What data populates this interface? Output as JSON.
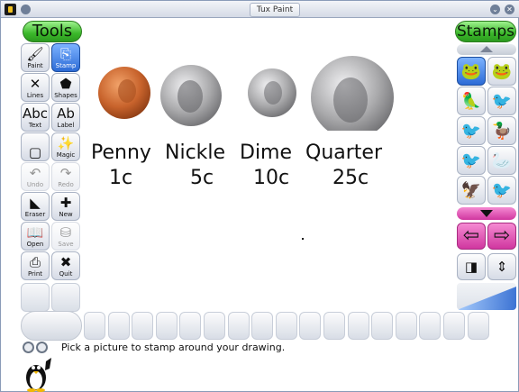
{
  "window": {
    "title": "Tux Paint"
  },
  "toolbar": {
    "header": "Tools",
    "tools": [
      {
        "label": "Paint",
        "icon": "paintbrush-icon",
        "glyph": "🖌",
        "selected": false,
        "disabled": false
      },
      {
        "label": "Stamp",
        "icon": "stamp-icon",
        "glyph": "⎘",
        "selected": true,
        "disabled": false
      },
      {
        "label": "Lines",
        "icon": "lines-icon",
        "glyph": "✕",
        "selected": false,
        "disabled": false
      },
      {
        "label": "Shapes",
        "icon": "pentagon-icon",
        "glyph": "⬟",
        "selected": false,
        "disabled": false
      },
      {
        "label": "Text",
        "icon": "text-icon",
        "glyph": "Abc",
        "selected": false,
        "disabled": false
      },
      {
        "label": "Label",
        "icon": "label-icon",
        "glyph": "Ab",
        "selected": false,
        "disabled": false
      },
      {
        "label": "",
        "icon": "fill-square-icon",
        "glyph": "▢",
        "selected": false,
        "disabled": false
      },
      {
        "label": "Magic",
        "icon": "magic-wand-icon",
        "glyph": "✨",
        "selected": false,
        "disabled": false
      },
      {
        "label": "Undo",
        "icon": "undo-icon",
        "glyph": "↶",
        "selected": false,
        "disabled": true
      },
      {
        "label": "Redo",
        "icon": "redo-icon",
        "glyph": "↷",
        "selected": false,
        "disabled": true
      },
      {
        "label": "Eraser",
        "icon": "eraser-icon",
        "glyph": "◣",
        "selected": false,
        "disabled": false
      },
      {
        "label": "New",
        "icon": "new-page-icon",
        "glyph": "✚",
        "selected": false,
        "disabled": false
      },
      {
        "label": "Open",
        "icon": "open-book-icon",
        "glyph": "📖",
        "selected": false,
        "disabled": false
      },
      {
        "label": "Save",
        "icon": "save-icon",
        "glyph": "⛁",
        "selected": false,
        "disabled": true
      },
      {
        "label": "Print",
        "icon": "print-icon",
        "glyph": "⎙",
        "selected": false,
        "disabled": false
      },
      {
        "label": "Quit",
        "icon": "quit-x-icon",
        "glyph": "✖",
        "selected": false,
        "disabled": false
      }
    ]
  },
  "canvas": {
    "coins": [
      {
        "name": "Penny",
        "value": "1c",
        "color": "#c8632c"
      },
      {
        "name": "Nickle",
        "value": "5c",
        "color": "#a9a9ab"
      },
      {
        "name": "Dime",
        "value": "10c",
        "color": "#b4b4b6"
      },
      {
        "name": "Quarter",
        "value": "25c",
        "color": "#a8a8aa"
      }
    ]
  },
  "stamps": {
    "header": "Stamps",
    "items": [
      {
        "icon": "frog-brown-icon",
        "glyph": "🐸",
        "selected": true
      },
      {
        "icon": "frog-green-icon",
        "glyph": "🐸",
        "selected": false
      },
      {
        "icon": "parrot-icon",
        "glyph": "🦜",
        "selected": false
      },
      {
        "icon": "bird-yellow-icon",
        "glyph": "🐦",
        "selected": false
      },
      {
        "icon": "crow-icon",
        "glyph": "🐦",
        "selected": false
      },
      {
        "icon": "duck-icon",
        "glyph": "🦆",
        "selected": false
      },
      {
        "icon": "blackbird-icon",
        "glyph": "🐦",
        "selected": false
      },
      {
        "icon": "crane-icon",
        "glyph": "🦢",
        "selected": false
      },
      {
        "icon": "hawk-icon",
        "glyph": "🦅",
        "selected": false
      },
      {
        "icon": "heron-icon",
        "glyph": "🐦",
        "selected": false
      }
    ],
    "prev_arrow": "⇦",
    "next_arrow": "⇨",
    "options": [
      {
        "icon": "mirror-icon",
        "glyph": "◨"
      },
      {
        "icon": "flip-icon",
        "glyph": "⇕"
      }
    ]
  },
  "colors": {
    "swatch_count": 17
  },
  "status": {
    "message": "Pick a picture to stamp around your drawing."
  }
}
